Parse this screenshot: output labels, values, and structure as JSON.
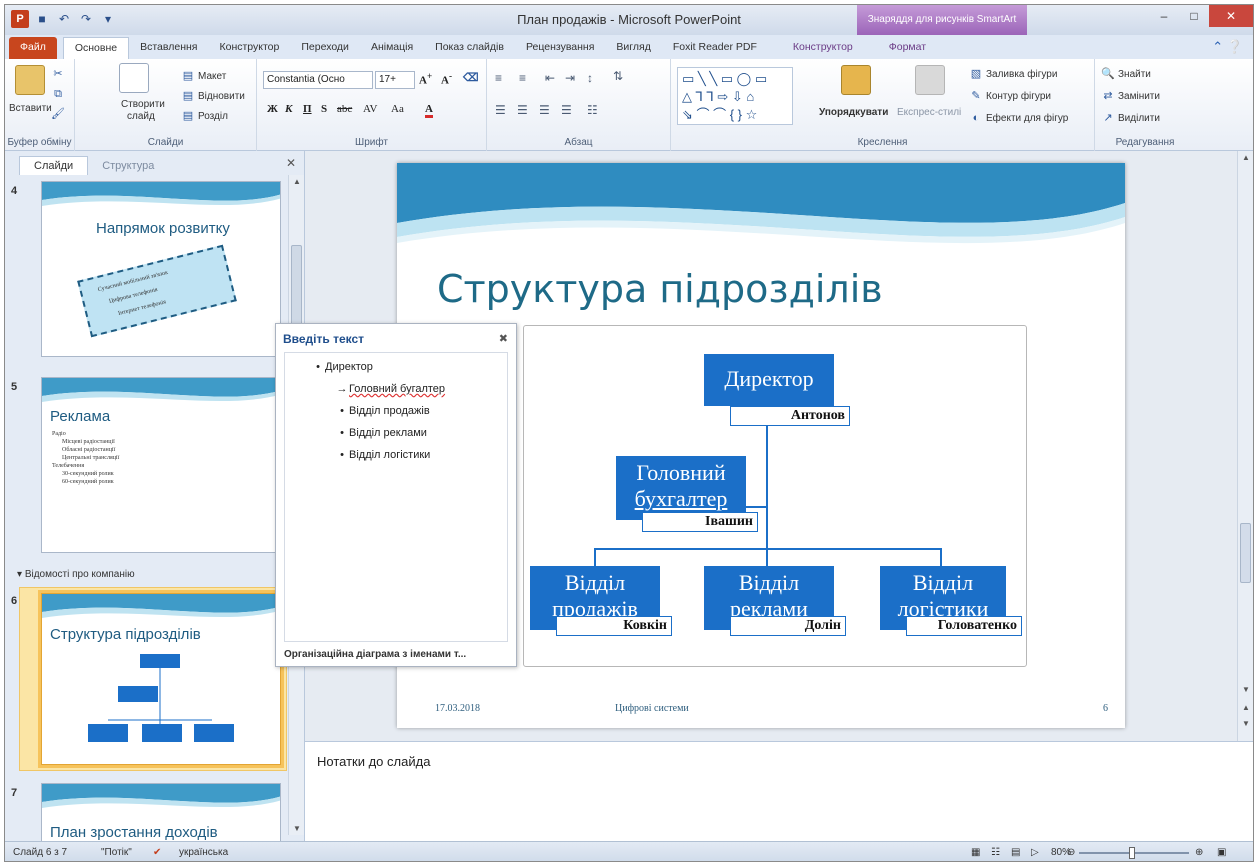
{
  "window": {
    "title": "План продажів - Microsoft PowerPoint",
    "context_tab_group": "Знаряддя для рисунків SmartArt",
    "qat_logo": "P"
  },
  "tabs": [
    "Файл",
    "Основне",
    "Вставлення",
    "Конструктор",
    "Переходи",
    "Анімація",
    "Показ слайдів",
    "Рецензування",
    "Вигляд",
    "Foxit Reader PDF",
    "Конструктор",
    "Формат"
  ],
  "ribbon": {
    "clipboard": {
      "paste": "Вставити",
      "label": "Буфер обміну"
    },
    "slides": {
      "new_slide_1": "Створити",
      "new_slide_2": "слайд",
      "layout": "Макет",
      "reset": "Відновити",
      "section": "Розділ",
      "label": "Слайди"
    },
    "font": {
      "name": "Constantia (Осно",
      "size": "17+",
      "label": "Шрифт",
      "bold": "Ж",
      "italic": "К",
      "underline": "П",
      "strike": "abc",
      "spacing": "AV",
      "case": "Aa",
      "color": "A"
    },
    "paragraph": {
      "label": "Абзац"
    },
    "drawing": {
      "arrange": "Упорядкувати",
      "quick_styles": "Експрес-стилі",
      "fill": "Заливка фігури",
      "outline": "Контур фігури",
      "effects": "Ефекти для фігур",
      "label": "Креслення"
    },
    "editing": {
      "find": "Знайти",
      "replace": "Замінити",
      "select": "Виділити",
      "label": "Редагування"
    }
  },
  "left_pane": {
    "tabs": [
      "Слайди",
      "Структура"
    ],
    "section_name": "Відомості про компанію",
    "thumbnails": [
      {
        "num": "4",
        "title": "Напрямок розвитку",
        "lines": [
          "Сучасний мобільний зв'язок",
          "Цифрова телефонія",
          "Інтернет телефонія"
        ]
      },
      {
        "num": "5",
        "title": "Реклама",
        "lines": [
          "Радіо",
          "Місцеві радіостанції",
          "Обласні радіостанції",
          "Центральні трансляції",
          "Телебачення",
          "30-секундний ролик",
          "60-секундний ролик"
        ]
      },
      {
        "num": "6",
        "title": "Структура підрозділів"
      },
      {
        "num": "7",
        "title": "План зростання доходів"
      }
    ]
  },
  "slide": {
    "title": "Структура підрозділів",
    "footer_date": "17.03.2018",
    "footer_text": "Цифрові системи",
    "footer_num": "6"
  },
  "org": {
    "director": {
      "role": "Директор",
      "name": "Антонов"
    },
    "accountant": {
      "role_1": "Головний",
      "role_2": "бухгалтер",
      "name": "Івашин"
    },
    "sales": {
      "role_1": "Відділ",
      "role_2": "продажів",
      "name": "Ковкін"
    },
    "ads": {
      "role_1": "Відділ",
      "role_2": "реклами",
      "name": "Долін"
    },
    "logistics": {
      "role_1": "Відділ",
      "role_2": "логістики",
      "name": "Головатенко"
    }
  },
  "text_pane": {
    "title": "Введіть текст",
    "items": [
      "Директор",
      "Головний бугалтер",
      "Відділ продажів",
      "Відділ реклами",
      "Відділ логістики"
    ],
    "footer": "Організаційна діаграма з іменами т..."
  },
  "notes": {
    "placeholder": "Нотатки до слайда"
  },
  "status": {
    "slide_info": "Слайд 6 з 7",
    "theme": "\"Потік\"",
    "language": "українська",
    "zoom": "80%"
  },
  "colors": {
    "accent": "#1b6fc8",
    "file_tab": "#c8461e",
    "title_text": "#1e6a87",
    "selection": "#f6c35b"
  }
}
